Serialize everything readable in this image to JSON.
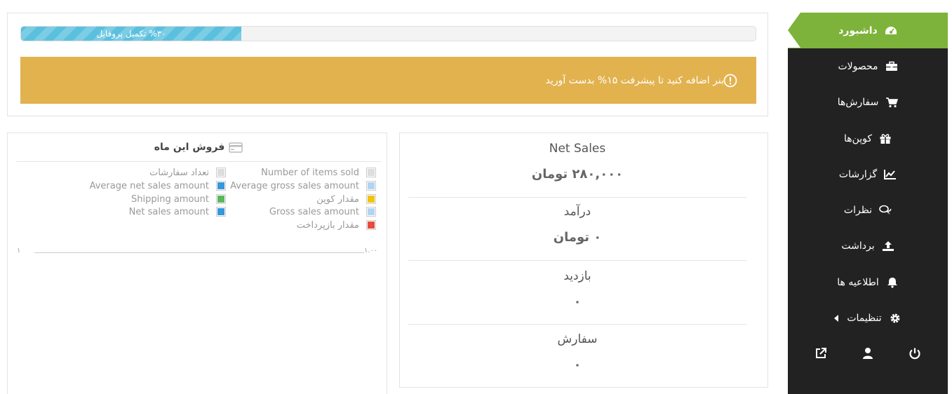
{
  "sidebar": {
    "items": [
      {
        "label": "داشبورد",
        "icon": "dashboard-icon",
        "active": true
      },
      {
        "label": "محصولات",
        "icon": "briefcase-icon"
      },
      {
        "label": "سفارش‌ها",
        "icon": "cart-icon"
      },
      {
        "label": "کوپن‌ها",
        "icon": "gift-icon"
      },
      {
        "label": "گزارشات",
        "icon": "chart-line-icon"
      },
      {
        "label": "نظرات",
        "icon": "comments-icon"
      },
      {
        "label": "برداشت",
        "icon": "upload-icon"
      },
      {
        "label": "اطلاعیه ها",
        "icon": "bell-icon"
      },
      {
        "label": "تنظیمات",
        "icon": "gear-icon",
        "has_submenu": true
      }
    ],
    "footer_icons": [
      "external-link-icon",
      "user-icon",
      "power-icon"
    ],
    "bg_color": "#222222",
    "active_color": "#7db33a"
  },
  "profile": {
    "progress_text": "%۳۰ تکمیل پروفایل",
    "progress_percent": 30,
    "bar_color": "#5bc0de"
  },
  "banner": {
    "text": "بنر اضافه کنید تا پیشرفت ۱۵% بدست آورید",
    "icon": "info-circle-icon",
    "color": "#e2b24f"
  },
  "stats": [
    {
      "label": "Net Sales",
      "value": "۲۸۰,۰۰۰ تومان"
    },
    {
      "label": "درآمد",
      "value": "۰ تومان"
    },
    {
      "label": "بازدید",
      "value": "۰"
    },
    {
      "label": "سفارش",
      "value": "۰"
    }
  ],
  "sales_chart": {
    "title": "فروش این ماه",
    "icon": "credit-card-icon",
    "legend": [
      {
        "label": "Number of items sold",
        "color": "#dddddd"
      },
      {
        "label": "تعداد سفارشات",
        "color": "#dddddd"
      },
      {
        "label": "Average gross sales amount",
        "color": "#b3d4f0"
      },
      {
        "label": "Average net sales amount",
        "color": "#3498db"
      },
      {
        "label": "مقدار کوپن",
        "color": "#f1c40f"
      },
      {
        "label": "Shipping amount",
        "color": "#5cb85c"
      },
      {
        "label": "Gross sales amount",
        "color": "#b3d4f0"
      },
      {
        "label": "Net sales amount",
        "color": "#3498db"
      },
      {
        "label": "مقدار بازپرداخت",
        "color": "#e74c3c"
      }
    ],
    "y_left_tick": "۱",
    "y_right_tick": "۱.۰۰"
  }
}
